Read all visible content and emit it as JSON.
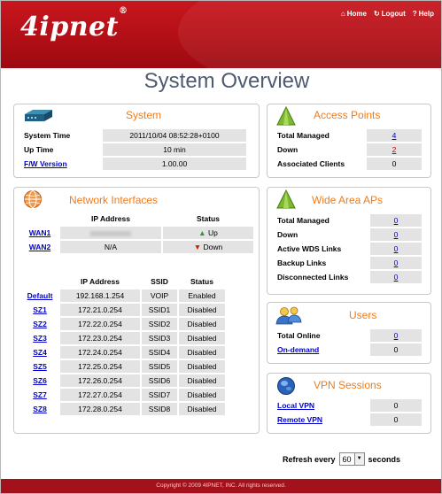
{
  "header": {
    "logo": "4ipnet",
    "logo_mark": "®",
    "nav": [
      {
        "icon": "home-icon",
        "glyph": "⌂",
        "label": "Home"
      },
      {
        "icon": "logout-icon",
        "glyph": "↻",
        "label": "Logout"
      },
      {
        "icon": "help-icon",
        "glyph": "?",
        "label": "Help"
      }
    ]
  },
  "page_title": "System Overview",
  "system": {
    "title": "System",
    "icon": "device-icon",
    "rows": [
      {
        "label": "System Time",
        "value": "2011/10/04 08:52:28+0100"
      },
      {
        "label": "Up Time",
        "value": "10 min"
      },
      {
        "label": "F/W Version",
        "value": "1.00.00"
      }
    ]
  },
  "network": {
    "title": "Network Interfaces",
    "icon": "network-globe-icon",
    "wan_headers": {
      "ip": "IP Address",
      "status": "Status"
    },
    "wan_rows": [
      {
        "name": "WAN1",
        "ip": "",
        "status": "Up",
        "status_icon": "arrow-up-icon",
        "status_color": "#2e9a2e"
      },
      {
        "name": "WAN2",
        "ip": "N/A",
        "status": "Down",
        "status_icon": "arrow-down-icon",
        "status_color": "#cc2200"
      }
    ],
    "sz_headers": {
      "ip": "IP Address",
      "ssid": "SSID",
      "status": "Status"
    },
    "sz_rows": [
      {
        "name": "Default",
        "ip": "192.168.1.254",
        "ssid": "VOIP",
        "status": "Enabled"
      },
      {
        "name": "SZ1",
        "ip": "172.21.0.254",
        "ssid": "SSID1",
        "status": "Disabled"
      },
      {
        "name": "SZ2",
        "ip": "172.22.0.254",
        "ssid": "SSID2",
        "status": "Disabled"
      },
      {
        "name": "SZ3",
        "ip": "172.23.0.254",
        "ssid": "SSID3",
        "status": "Disabled"
      },
      {
        "name": "SZ4",
        "ip": "172.24.0.254",
        "ssid": "SSID4",
        "status": "Disabled"
      },
      {
        "name": "SZ5",
        "ip": "172.25.0.254",
        "ssid": "SSID5",
        "status": "Disabled"
      },
      {
        "name": "SZ6",
        "ip": "172.26.0.254",
        "ssid": "SSID6",
        "status": "Disabled"
      },
      {
        "name": "SZ7",
        "ip": "172.27.0.254",
        "ssid": "SSID7",
        "status": "Disabled"
      },
      {
        "name": "SZ8",
        "ip": "172.28.0.254",
        "ssid": "SSID8",
        "status": "Disabled"
      }
    ]
  },
  "access_points": {
    "title": "Access Points",
    "icon": "access-point-icon",
    "rows": [
      {
        "label": "Total Managed",
        "value": "4"
      },
      {
        "label": "Down",
        "value": "2"
      },
      {
        "label": "Associated Clients",
        "value": "0"
      }
    ]
  },
  "wide_area_aps": {
    "title": "Wide Area APs",
    "icon": "wide-area-ap-icon",
    "rows": [
      {
        "label": "Total Managed",
        "value": "0"
      },
      {
        "label": "Down",
        "value": "0"
      },
      {
        "label": "Active WDS Links",
        "value": "0"
      },
      {
        "label": "Backup Links",
        "value": "0"
      },
      {
        "label": "Disconnected Links",
        "value": "0"
      }
    ]
  },
  "users": {
    "title": "Users",
    "icon": "users-icon",
    "rows": [
      {
        "label": "Total Online",
        "value": "0"
      },
      {
        "label": "On-demand",
        "value": "0"
      }
    ]
  },
  "vpn": {
    "title": "VPN Sessions",
    "icon": "vpn-globe-icon",
    "rows": [
      {
        "label": "Local VPN",
        "value": "0"
      },
      {
        "label": "Remote VPN",
        "value": "0"
      }
    ]
  },
  "refresh": {
    "prefix": "Refresh every",
    "value": "60",
    "suffix": "seconds"
  },
  "footer": "Copyright © 2009 4IPNET, INC. All rights reserved."
}
